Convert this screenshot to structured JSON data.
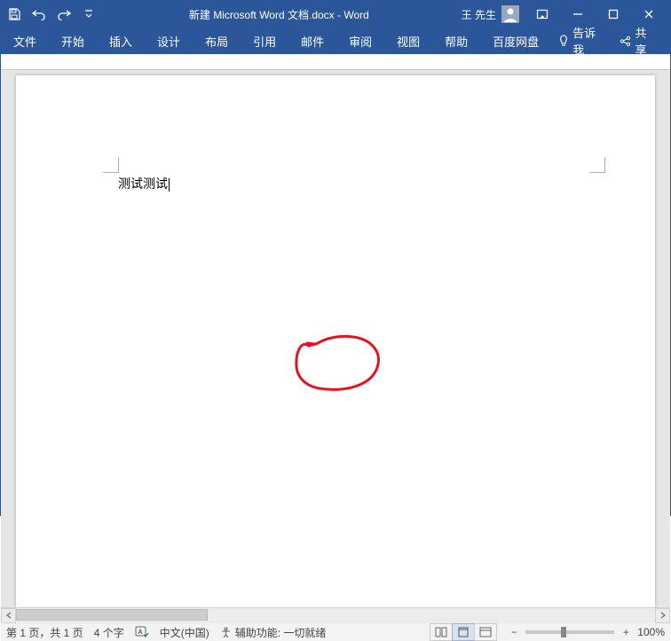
{
  "titlebar": {
    "document_name": "新建 Microsoft Word 文档.docx",
    "app_name": "Word",
    "separator": "  -  ",
    "user_name": "王 先生"
  },
  "ribbon": {
    "tabs": [
      "文件",
      "开始",
      "插入",
      "设计",
      "布局",
      "引用",
      "邮件",
      "审阅",
      "视图",
      "帮助",
      "百度网盘"
    ],
    "tell_me": "告诉我",
    "share": "共享"
  },
  "document": {
    "body_text": "测试测试"
  },
  "statusbar": {
    "page_info": "第 1 页，共 1 页",
    "word_count": "4 个字",
    "language": "中文(中国)",
    "accessibility": "辅助功能: 一切就绪",
    "zoom_percent": "100%"
  }
}
